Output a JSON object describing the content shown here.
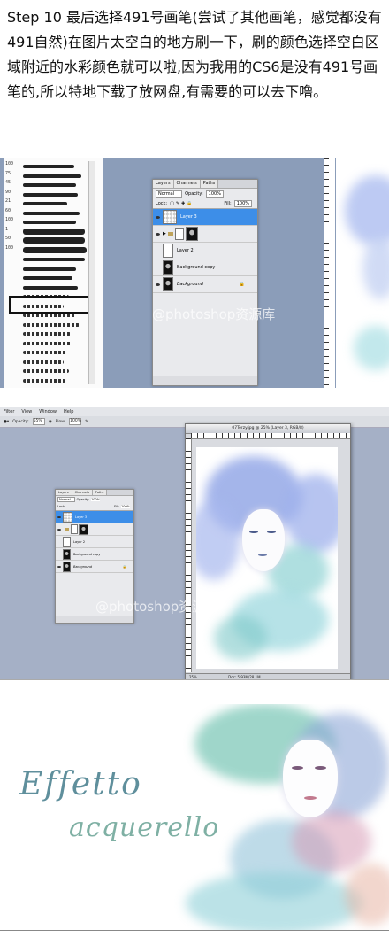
{
  "caption": "Step 10 最后选择491号画笔(尝试了其他画笔，感觉都没有491自然)在图片太空白的地方刷一下，刷的颜色选择空白区域附近的水彩颜色就可以啦,因为我用的CS6是没有491号画笔的,所以特地下载了放网盘,有需要的可以去下噜。",
  "watermark": "@photoshop资源库",
  "brush_numbers": [
    "100",
    "75",
    "45",
    "90",
    "21",
    "60",
    "100",
    "1",
    "50",
    "100",
    "",
    "",
    "",
    "",
    "",
    "",
    "",
    "",
    "",
    "",
    "",
    "",
    "",
    ""
  ],
  "layers_panel": {
    "tabs": [
      "Layers",
      "Channels",
      "Paths"
    ],
    "blend_mode": "Normal",
    "opacity_label": "Opacity:",
    "opacity_value": "100%",
    "lock_label": "Lock:",
    "fill_label": "Fill:",
    "fill_value": "100%",
    "layers": [
      {
        "name": "Layer 3",
        "selected": true
      },
      {
        "name": "",
        "selected": false
      },
      {
        "name": "Layer 2",
        "selected": false
      },
      {
        "name": "Background copy",
        "selected": false
      },
      {
        "name": "Background",
        "selected": false
      }
    ]
  },
  "menubar": {
    "items": [
      "Filter",
      "View",
      "Window",
      "Help"
    ]
  },
  "options_bar": {
    "opacity_label": "Opacity:",
    "opacity_value": "55%",
    "flow_label": "Flow:",
    "flow_value": "100%"
  },
  "document": {
    "title": "07Terzy.jpg @ 25% (Layer 3, RGB/8)",
    "zoom": "25%",
    "doc_size": "Doc: 5.93M/28.1M"
  },
  "final_art": {
    "line1": "Effetto",
    "line2": "acquerello"
  },
  "colors": {
    "ps_workspace": "#8b9db9",
    "selected_layer": "#3d8ee8",
    "watercolor_blue": "#8fa8e8",
    "watercolor_teal": "#7fc9c9",
    "watercolor_pink": "#d79cb6"
  }
}
